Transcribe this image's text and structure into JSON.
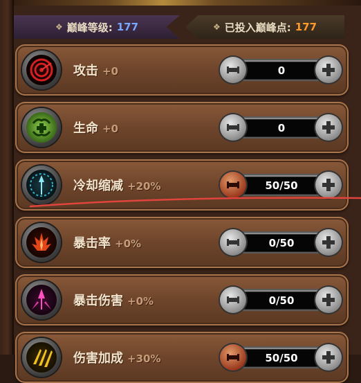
{
  "header": {
    "peak_level_label": "巅峰等级:",
    "peak_level_value": "177",
    "invested_label": "已投入巅峰点:",
    "invested_value": "177"
  },
  "rows": [
    {
      "name": "攻击",
      "bonus": "+0",
      "value": "0",
      "icon": "attack-target-icon",
      "icon_color": "#b41f1f"
    },
    {
      "name": "生命",
      "bonus": "+0",
      "value": "0",
      "icon": "life-cross-icon",
      "icon_color": "#5cae2b"
    },
    {
      "name": "冷却缩减",
      "bonus": "+20%",
      "value": "50/50",
      "icon": "cooldown-spear-icon",
      "icon_color": "#2a8ea3"
    },
    {
      "name": "暴击率",
      "bonus": "+0%",
      "value": "0/50",
      "icon": "crit-rate-flame-icon",
      "icon_color": "#c23a16"
    },
    {
      "name": "暴击伤害",
      "bonus": "+0%",
      "value": "0/50",
      "icon": "crit-damage-spear-icon",
      "icon_color": "#c2248e"
    },
    {
      "name": "伤害加成",
      "bonus": "+30%",
      "value": "50/50",
      "icon": "damage-bonus-claw-icon",
      "icon_color": "#c8a018"
    }
  ],
  "colors": {
    "level_value": "#7aa6ff",
    "invested_value": "#ff9a2a",
    "annotation_line": "#e0443c"
  }
}
